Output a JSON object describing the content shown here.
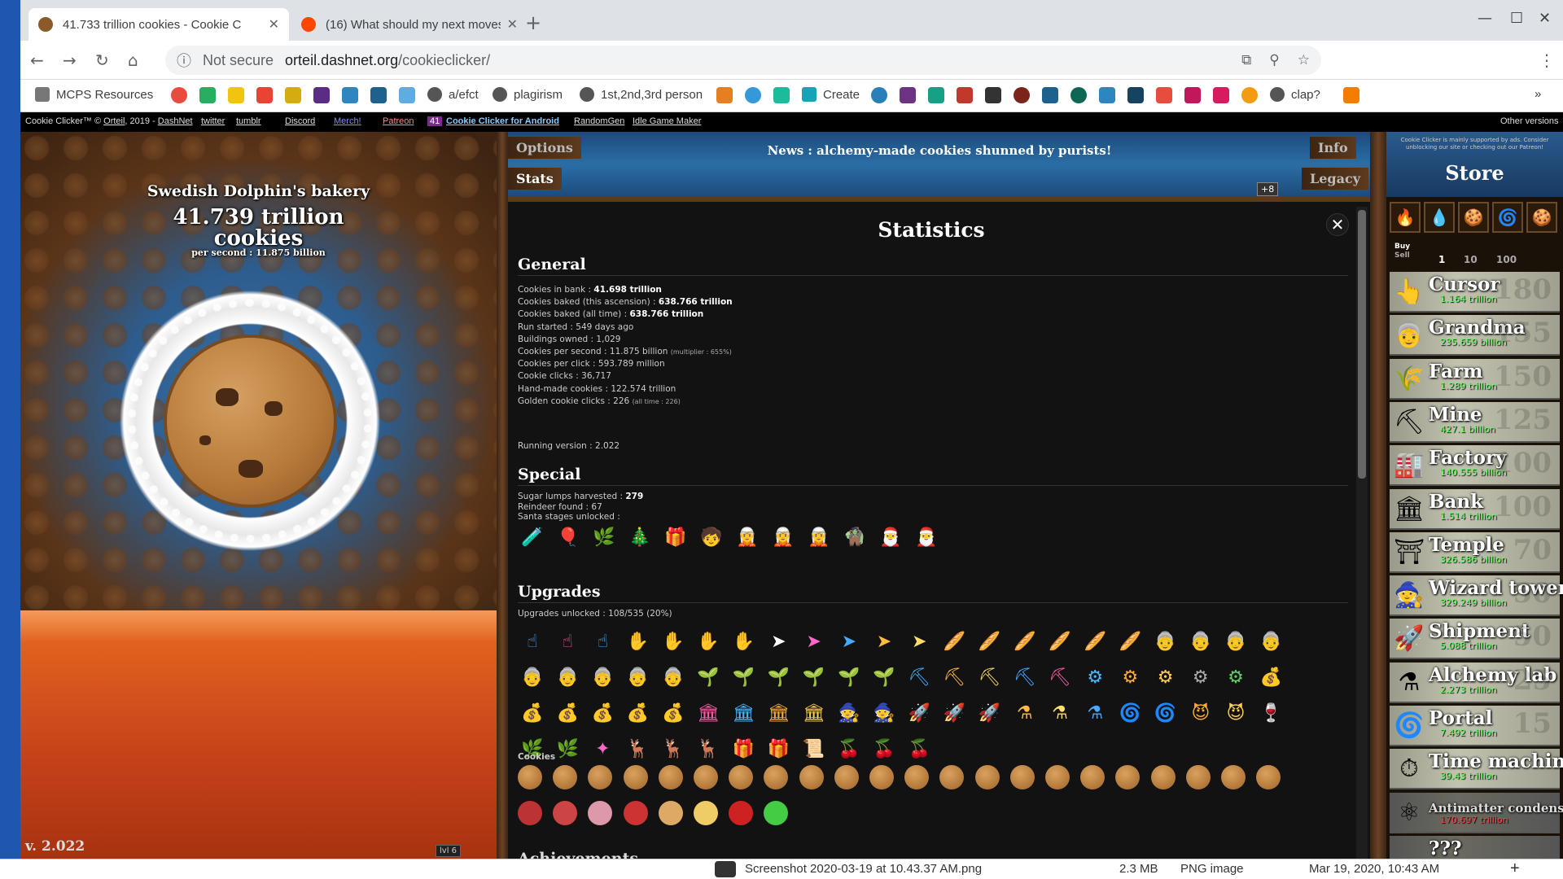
{
  "browser": {
    "tabs": [
      {
        "title": "41.733 trillion cookies - Cookie C",
        "active": true
      },
      {
        "title": "(16) What should my next moves",
        "active": false
      }
    ],
    "security": "Not secure",
    "url_host": "orteil.dashnet.org",
    "url_path": "/cookieclicker/",
    "bookmarks": [
      "MCPS Resources",
      "a/efct",
      "plagirism",
      "1st,2nd,3rd person",
      "Create",
      "clap?"
    ]
  },
  "game_links": [
    "Cookie Clicker™ © ",
    "Orteil",
    ", 2019 - ",
    "DashNet",
    "twitter",
    "tumblr",
    "Discord",
    "Merch!",
    "Patreon",
    "41",
    "Cookie Clicker for Android",
    "RandomGen",
    "Idle Game Maker",
    "Other versions"
  ],
  "bakery": {
    "name": "Swedish Dolphin's bakery",
    "cookies": "41.739 trillion",
    "unit": "cookies",
    "per_second": "per second : 11.875 billion",
    "version": "v. 2.022",
    "level": "lvl 6"
  },
  "menu": {
    "options": "Options",
    "stats": "Stats",
    "info": "Info",
    "legacy": "Legacy",
    "plus": "+8"
  },
  "news": "News : alchemy-made cookies shunned by purists!",
  "stats": {
    "title": "Statistics",
    "general_title": "General",
    "general": [
      {
        "label": "Cookies in bank :",
        "value": "41.698 trillion",
        "bold": true
      },
      {
        "label": "Cookies baked (this ascension) :",
        "value": "638.766 trillion",
        "bold": true
      },
      {
        "label": "Cookies baked (all time) :",
        "value": "638.766 trillion",
        "bold": true
      },
      {
        "label": "Run started :",
        "value": "549 days ago"
      },
      {
        "label": "Buildings owned :",
        "value": "1,029"
      },
      {
        "label": "Cookies per second :",
        "value": "11.875 billion",
        "note": "(multiplier : 655%)"
      },
      {
        "label": "Cookies per click :",
        "value": "593.789 million"
      },
      {
        "label": "Cookie clicks :",
        "value": "36,717"
      },
      {
        "label": "Hand-made cookies :",
        "value": "122.574 trillion"
      },
      {
        "label": "Golden cookie clicks :",
        "value": "226",
        "note": "(all time : 226)"
      }
    ],
    "running_version": "Running version : 2.022",
    "special_title": "Special",
    "special": [
      {
        "label": "Sugar lumps harvested :",
        "value": "279",
        "bold": true
      },
      {
        "label": "Reindeer found :",
        "value": "67"
      },
      {
        "label": "Santa stages unlocked :",
        "value": ""
      }
    ],
    "upgrades_title": "Upgrades",
    "upgrades_unlocked": "Upgrades unlocked : 108/535 (20%)",
    "cookies_label": "Cookies",
    "achievements_title": "Achievements"
  },
  "store": {
    "ad_note": "Cookie Clicker is mainly supported by ads. Consider unblocking our site or checking out our Patreon!",
    "title": "Store",
    "buy": "Buy",
    "sell": "Sell",
    "quantities": [
      "1",
      "10",
      "100"
    ],
    "buildings": [
      {
        "name": "Cursor",
        "price": "1.164 trillion",
        "count": "180",
        "icon": "👆"
      },
      {
        "name": "Grandma",
        "price": "235.659 billion",
        "count": "155",
        "icon": "👵"
      },
      {
        "name": "Farm",
        "price": "1.289 trillion",
        "count": "150",
        "icon": "🌾"
      },
      {
        "name": "Mine",
        "price": "427.1 billion",
        "count": "125",
        "icon": "⛏"
      },
      {
        "name": "Factory",
        "price": "140.555 billion",
        "count": "100",
        "icon": "🏭"
      },
      {
        "name": "Bank",
        "price": "1.514 trillion",
        "count": "100",
        "icon": "🏛"
      },
      {
        "name": "Temple",
        "price": "326.586 billion",
        "count": "70",
        "icon": "⛩"
      },
      {
        "name": "Wizard tower",
        "price": "329.249 billion",
        "count": "50",
        "icon": "🧙"
      },
      {
        "name": "Shipment",
        "price": "5.088 trillion",
        "count": "50",
        "icon": "🚀"
      },
      {
        "name": "Alchemy lab",
        "price": "2.273 trillion",
        "count": "25",
        "icon": "⚗"
      },
      {
        "name": "Portal",
        "price": "7.492 trillion",
        "count": "15",
        "icon": "🌀"
      },
      {
        "name": "Time machine",
        "price": "39.43 trillion",
        "count": "",
        "icon": "⏱"
      },
      {
        "name": "Antimatter condenser",
        "price": "170.697 trillion",
        "count": "",
        "icon": "⚛"
      },
      {
        "name": "???",
        "price": "",
        "count": "",
        "icon": ""
      }
    ]
  },
  "download": {
    "file": "Screenshot 2020-03-19 at 10.43.37 AM.png",
    "size": "2.3 MB",
    "type": "PNG image",
    "date": "Mar 19, 2020, 10:43 AM"
  }
}
